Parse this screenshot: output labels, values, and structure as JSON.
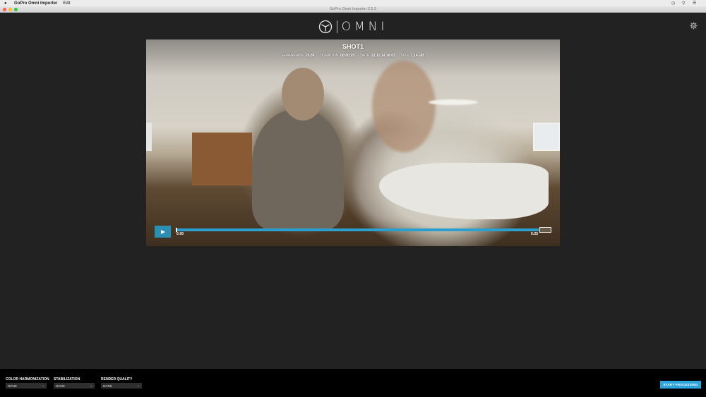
{
  "menubar": {
    "app_name": "GoPro Omni Importer",
    "menu_edit": "Edit"
  },
  "window": {
    "title": "GoPro Omni Importer 2.5.3"
  },
  "logo": {
    "text": "OMNI"
  },
  "player": {
    "shot_title": "SHOT1",
    "meta": {
      "framerate_label": "FRAMERATE",
      "framerate_value": "25.00",
      "duration_label": "DURATION",
      "duration_value": "00:00:25",
      "date_label": "DATE",
      "date_value": "22.12.14 16:03",
      "size_label": "SIZE",
      "size_value": "1,14 GB"
    },
    "time_start": "0:00",
    "time_end": "0:25",
    "progress": 0
  },
  "bottom": {
    "color_harmonization": {
      "label": "COLOR HARMONIZATION",
      "value": "NONE"
    },
    "stabilization": {
      "label": "STABILIZATION",
      "value": "NONE"
    },
    "render_quality": {
      "label": "RENDER QUALITY",
      "value": "NONE"
    },
    "start_button": "START PROCESSING"
  },
  "colors": {
    "accent": "#2ea4dc",
    "background": "#222222",
    "bottom_bar": "#000000"
  },
  "icons": {
    "settings": "gear-icon",
    "play": "play-icon",
    "logo": "omni-cube-icon"
  }
}
